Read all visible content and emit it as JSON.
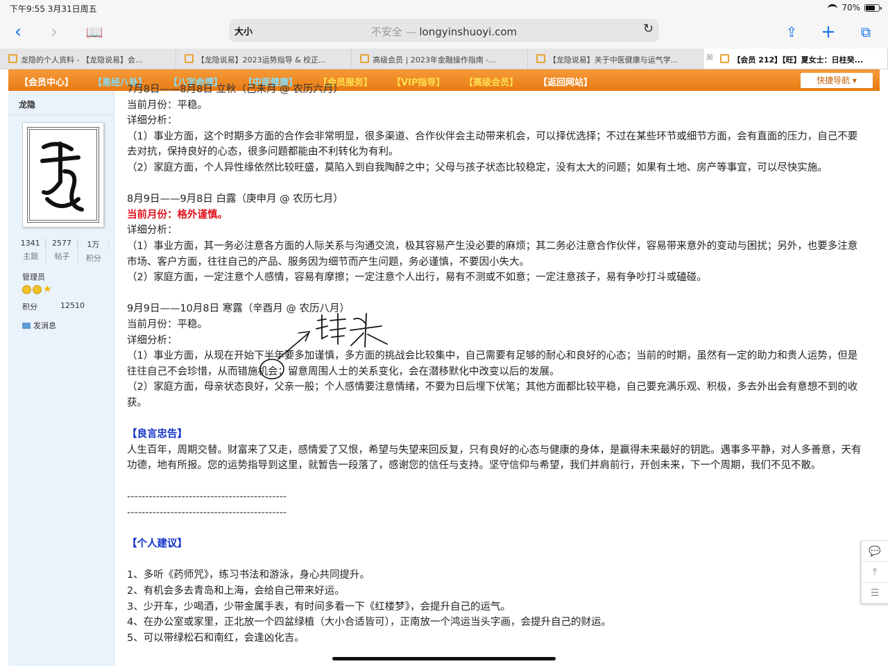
{
  "status_bar": {
    "time": "下午9:55   3月31日周五",
    "battery": "70%",
    "battery_level": 0.7
  },
  "toolbar": {
    "text_size_label": "大小",
    "insecure_label": "不安全 — ",
    "url": "longyinshuoyi.com"
  },
  "tabs": [
    {
      "label": "龙隐的个人资料 - 【龙隐说易】会..."
    },
    {
      "label": "【龙隐说易】2023运势指导 & 校正..."
    },
    {
      "label": "高级会员 | 2023年金融操作指南 -..."
    },
    {
      "label": "【龙隐说易】关于中医健康与运气学..."
    },
    {
      "label": "【会员 212】【旺】夏女士：日柱癸..."
    }
  ],
  "nav": {
    "items": [
      {
        "label": "【会员中心】",
        "color": "#ffffff"
      },
      {
        "label": "【易经八卦】",
        "color": "#7fe0ff"
      },
      {
        "label": "【八字命理】",
        "color": "#7fe0ff"
      },
      {
        "label": "【中医健康】",
        "color": "#7fe0ff"
      },
      {
        "label": "【会员服务】",
        "color": "#ffe14d"
      },
      {
        "label": "【VIP指导】",
        "color": "#ffe14d"
      },
      {
        "label": "【高级会员】",
        "color": "#ffe14d"
      },
      {
        "label": "【返回网站】",
        "color": "#ffffff"
      }
    ],
    "quick_nav": "快捷导航"
  },
  "sidebar": {
    "username": "龙隐",
    "stats": [
      {
        "value": "1341",
        "label": "主题"
      },
      {
        "value": "2577",
        "label": "帖子"
      },
      {
        "value": "1万",
        "label": "积分"
      }
    ],
    "role": "管理员",
    "points_label": "积分",
    "points_value": "12510",
    "message": "发消息"
  },
  "content": {
    "l0": "7月8日——8月8日 立秋（己未月 @ 农历六月）",
    "l1": "当前月份：平稳。",
    "l2": "详细分析：",
    "l3": "（1）事业方面，这个时期多方面的合作会非常明显，很多渠道、合作伙伴会主动带来机会，可以择优选择；不过在某些环节或细节方面，会有直面的压力，自己不要去对抗，保持良好的心态，很多问题都能由不利转化为有利。",
    "l4": "（2）家庭方面，个人异性缘依然比较旺盛，莫陷入到自我陶醉之中；父母与孩子状态比较稳定，没有太大的问题；如果有土地、房产等事宜，可以尽快实施。",
    "s2_title": "8月9日——9月8日 白露（庚申月 @ 农历七月）",
    "s2_month": "当前月份：格外谨慎。",
    "s2_detail": "详细分析：",
    "s2_p1": "（1）事业方面，其一务必注意各方面的人际关系与沟通交流，极其容易产生没必要的麻烦；其二务必注意合作伙伴，容易带来意外的变动与困扰；另外，也要多注意市场、客户方面，往往自己的产品、服务因为细节而产生问题，务必谨慎，不要因小失大。",
    "s2_p2": "（2）家庭方面，一定注意个人感情，容易有摩擦；一定注意个人出行，易有不测或不如意；一定注意孩子，易有争吵打斗或磕碰。",
    "s3_title": "9月9日——10月8日 寒露（辛酉月 @ 农历八月）",
    "s3_month": "当前月份：平稳。",
    "s3_detail": "详细分析：",
    "s3_p1": "（1）事业方面，从现在开始下半年要多加谨慎，多方面的挑战会比较集中，自己需要有足够的耐心和良好的心态；当前的时期，虽然有一定的助力和贵人运势，但是往往自己不会珍惜，从而错施机会；留意周围人士的关系变化，会在潜移默化中改变以后的发展。",
    "s3_p2": "（2）家庭方面，母亲状态良好，父亲一般；个人感情要注意情绪，不要为日后埋下伏笔；其他方面都比较平稳，自己要充满乐观、积极，多去外出会有意想不到的收获。",
    "advice_title": "【良言忠告】",
    "advice": "人生百年，周期交替。财富来了又走，感情爱了又恨，希望与失望来回反复，只有良好的心态与健康的身体，是赢得未来最好的钥匙。遇事多平静，对人多善意，天有功德，地有所报。您的运势指导到这里，就暂告一段落了，感谢您的信任与支持。坚守信仰与希望，我们并肩前行，开创未来，下一个周期，我们不见不散。",
    "dash1": "--------------------------------------------",
    "dash2": "--------------------------------------------",
    "personal_title": "【个人建议】",
    "tips": [
      "1、多听《药师咒》，练习书法和游泳，身心共同提升。",
      "2、有机会多去青岛和上海，会给自己带来好运。",
      "3、少开车，少喝酒，少带金属手表，有时间多看一下《红楼梦》，会提升自己的运气。",
      "4、在办公室或家里，正北放一个四盆绿植（大小合适皆可），正南放一个鸿运当头字画，会提升自己的财运。",
      "5、可以带绿松石和南红，会逢凶化吉。"
    ]
  }
}
